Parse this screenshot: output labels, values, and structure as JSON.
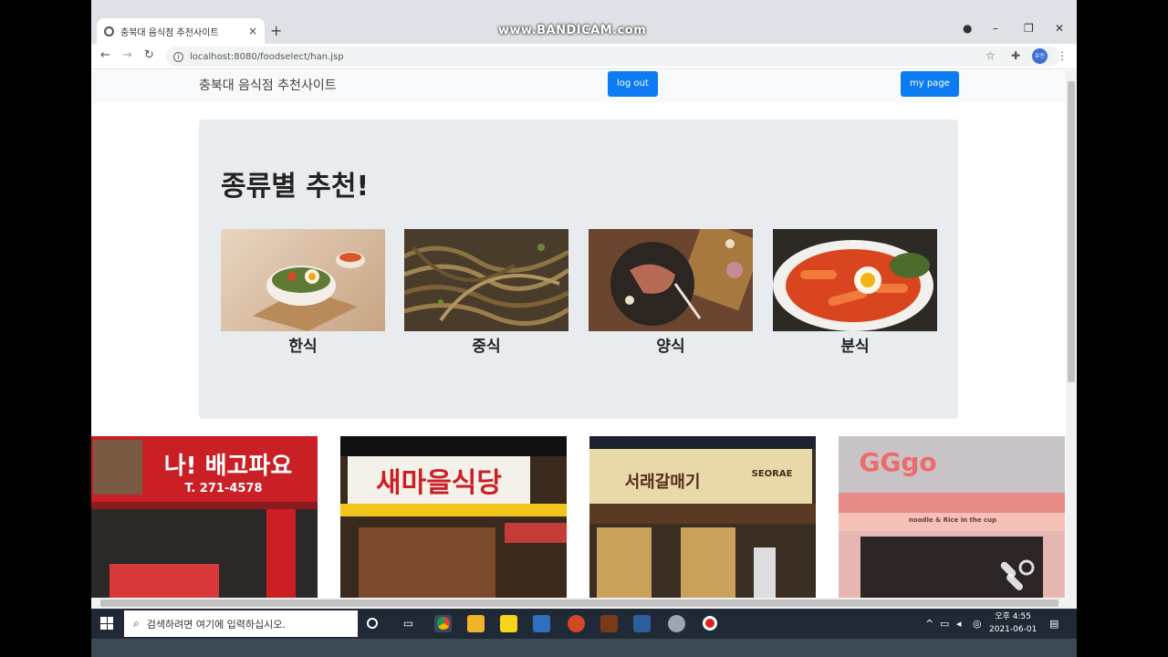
{
  "browser": {
    "tab_title": "충북대 음식점 추천사이트",
    "tab_close": "×",
    "new_tab": "+",
    "watermark": "www.BANDICAM.com",
    "url": "localhost:8080/foodselect/han.jsp",
    "avatar_text": "유진"
  },
  "navbar": {
    "brand": "충북대 음식점 추천사이트",
    "logout_label": "log out",
    "mypage_label": "my page"
  },
  "jumbotron": {
    "title": "종류별 추천!",
    "categories": [
      {
        "label": "한식",
        "icon": "bibimbap-photo"
      },
      {
        "label": "중식",
        "icon": "jjajang-noodle-photo"
      },
      {
        "label": "양식",
        "icon": "steak-photo"
      },
      {
        "label": "분식",
        "icon": "tteokbokki-photo"
      }
    ]
  },
  "restaurants": [
    {
      "sign": "나! 배고파요",
      "phone": "T. 271-4578"
    },
    {
      "sign": "새마을식당"
    },
    {
      "sign": "서래갈매기",
      "sub": "SEORAE"
    },
    {
      "sign": "GGgo",
      "sub": "noodle & Rice in the cup"
    }
  ],
  "taskbar": {
    "search_placeholder": "검색하려면 여기에 입력하십시오.",
    "time": "오후 4:55",
    "date": "2021-06-01"
  }
}
